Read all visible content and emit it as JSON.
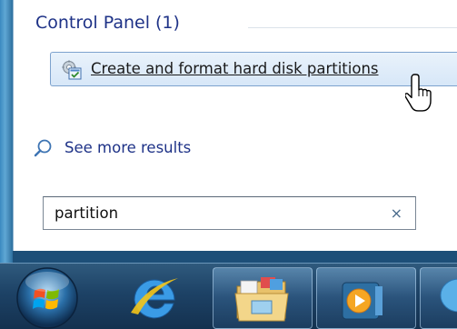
{
  "start_menu": {
    "group_header": "Control Panel (1)",
    "result_item": {
      "label": "Create and format hard disk partitions",
      "icon": "control-panel-icon"
    },
    "see_more": {
      "label": "See more results",
      "icon": "magnifier-icon"
    },
    "search": {
      "value": "partition",
      "clear_symbol": "×"
    }
  },
  "taskbar": {
    "items": [
      {
        "name": "start-button",
        "icon": "windows-orb-icon"
      },
      {
        "name": "internet-explorer",
        "icon": "internet-explorer-icon"
      },
      {
        "name": "windows-explorer",
        "icon": "folder-libraries-icon"
      },
      {
        "name": "windows-media-player",
        "icon": "media-player-icon"
      },
      {
        "name": "partial-app",
        "icon": "app-icon"
      }
    ]
  },
  "colors": {
    "header_text": "#1e3287",
    "highlight_border": "#7da2ce",
    "taskbar": "#1d4266"
  }
}
